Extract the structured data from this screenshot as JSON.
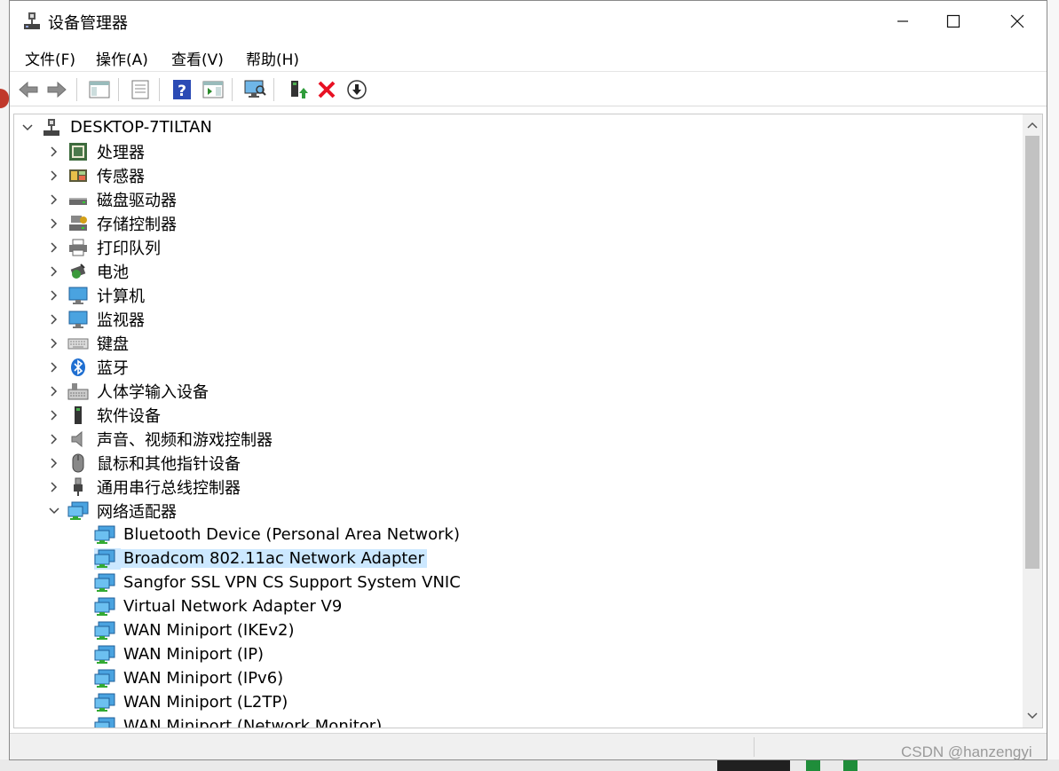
{
  "window": {
    "title": "设备管理器",
    "controls": {
      "minimize": "minimize-icon",
      "maximize": "maximize-icon",
      "close": "close-icon"
    }
  },
  "menu": [
    {
      "label": "文件(F)"
    },
    {
      "label": "操作(A)"
    },
    {
      "label": "查看(V)"
    },
    {
      "label": "帮助(H)"
    }
  ],
  "toolbar": {
    "icons": [
      "back-arrow-icon",
      "forward-arrow-icon",
      "show-hide-console-tree-icon",
      "properties-icon",
      "help-icon",
      "action-pane-icon",
      "scan-hardware-icon",
      "update-driver-icon",
      "uninstall-device-icon",
      "disable-device-icon"
    ]
  },
  "tree": {
    "root": {
      "label": "DESKTOP-7TILTAN",
      "expanded": true
    },
    "categories": [
      {
        "label": "处理器",
        "icon": "processor-icon"
      },
      {
        "label": "传感器",
        "icon": "sensor-icon"
      },
      {
        "label": "磁盘驱动器",
        "icon": "disk-drive-icon"
      },
      {
        "label": "存储控制器",
        "icon": "storage-controller-icon"
      },
      {
        "label": "打印队列",
        "icon": "printer-icon"
      },
      {
        "label": "电池",
        "icon": "battery-icon"
      },
      {
        "label": "计算机",
        "icon": "computer-icon"
      },
      {
        "label": "监视器",
        "icon": "monitor-icon"
      },
      {
        "label": "键盘",
        "icon": "keyboard-icon"
      },
      {
        "label": "蓝牙",
        "icon": "bluetooth-icon"
      },
      {
        "label": "人体学输入设备",
        "icon": "hid-icon"
      },
      {
        "label": "软件设备",
        "icon": "software-device-icon"
      },
      {
        "label": "声音、视频和游戏控制器",
        "icon": "speaker-icon"
      },
      {
        "label": "鼠标和其他指针设备",
        "icon": "mouse-icon"
      },
      {
        "label": "通用串行总线控制器",
        "icon": "usb-icon"
      },
      {
        "label": "网络适配器",
        "icon": "network-adapter-icon",
        "expanded": true
      }
    ],
    "network_adapters": [
      {
        "label": "Bluetooth Device (Personal Area Network)"
      },
      {
        "label": "Broadcom 802.11ac Network Adapter",
        "selected": true
      },
      {
        "label": "Sangfor SSL VPN CS Support System VNIC"
      },
      {
        "label": "Virtual Network Adapter V9"
      },
      {
        "label": "WAN Miniport (IKEv2)"
      },
      {
        "label": "WAN Miniport (IP)"
      },
      {
        "label": "WAN Miniport (IPv6)"
      },
      {
        "label": "WAN Miniport (L2TP)"
      },
      {
        "label": "WAN Miniport (Network Monitor)"
      }
    ]
  },
  "watermark": "CSDN @hanzengyi",
  "colors": {
    "selection": "#cce8ff",
    "monitor_blue": "#2e86de",
    "delete_red": "#e81123"
  }
}
